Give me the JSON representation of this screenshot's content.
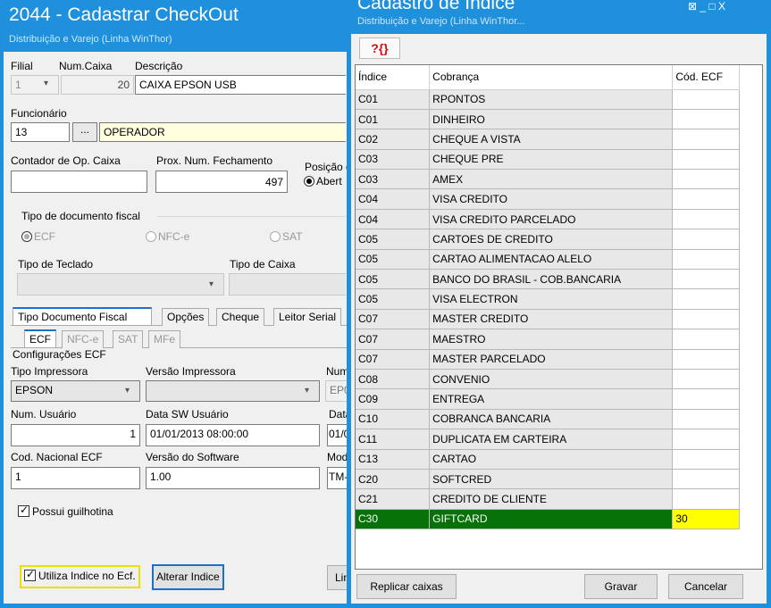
{
  "back": {
    "title": "2044 - Cadastrar CheckOut",
    "subtitle": "Distribuição e Varejo (Linha WinThor)",
    "filial_label": "Filial",
    "filial_value": "1",
    "numcaixa_label": "Num.Caixa",
    "numcaixa_value": "20",
    "descricao_label": "Descrição",
    "descricao_value": "CAIXA EPSON USB",
    "funcionario_label": "Funcionário",
    "funcionario_code": "13",
    "funcionario_btn": "...",
    "funcionario_name": "OPERADOR",
    "contador_label": "Contador de Op. Caixa",
    "contador_value": "",
    "prox_label": "Prox. Num. Fechamento",
    "prox_value": "497",
    "posicao_label": "Posição c",
    "posicao_option": "Abert",
    "tipodoc_label": "Tipo de documento fiscal",
    "tipodoc_options": [
      "ECF",
      "NFC-e",
      "SAT"
    ],
    "teclado_label": "Tipo de Teclado",
    "caixa_label": "Tipo de Caixa",
    "tabs_main": [
      "Tipo Documento Fiscal",
      "Opções",
      "Cheque",
      "Leitor Serial"
    ],
    "tabs_sub": [
      "ECF",
      "NFC-e",
      "SAT",
      "MFe"
    ],
    "config_label": "Configurações ECF",
    "impressora_label": "Tipo Impressora",
    "impressora_value": "EPSON",
    "versao_imp_label": "Versão Impressora",
    "num_label": "Num",
    "num_value": "EP0",
    "numusuario_label": "Num. Usuário",
    "numusuario_value": "1",
    "datasw_label": "Data  SW Usuário",
    "datasw_value": "01/01/2013 08:00:00",
    "data_label": "Data",
    "data_value": "01/0",
    "codnac_label": "Cod. Nacional ECF",
    "codnac_value": "1",
    "versaosw_label": "Versão do Software",
    "versaosw_value": "1.00",
    "modelo_label": "Mode",
    "modelo_value": "TM-",
    "guilhotina_label": "Possui guilhotina",
    "utiliza_label": "Utiliza Indice no Ecf.",
    "alterar_label": "Alterar Indice",
    "lim_label": "Lin"
  },
  "front": {
    "title": "Cadastro de Indice",
    "subtitle": "Distribuição e Varejo (Linha WinThor...",
    "window_controls": "⊠ _ □ X",
    "toolbar_icon": "?{}",
    "columns": [
      "Índice",
      "Cobrança",
      "Cód. ECF"
    ],
    "rows": [
      [
        "C01",
        "RPONTOS",
        ""
      ],
      [
        "C01",
        "DINHEIRO",
        ""
      ],
      [
        "C02",
        "CHEQUE A VISTA",
        ""
      ],
      [
        "C03",
        "CHEQUE PRE",
        ""
      ],
      [
        "C03",
        "AMEX",
        ""
      ],
      [
        "C04",
        "VISA CREDITO",
        ""
      ],
      [
        "C04",
        "VISA CREDITO PARCELADO",
        ""
      ],
      [
        "C05",
        "CARTOES DE CREDITO",
        ""
      ],
      [
        "C05",
        "CARTAO ALIMENTACAO ALELO",
        ""
      ],
      [
        "C05",
        "BANCO DO BRASIL - COB.BANCARIA",
        ""
      ],
      [
        "C05",
        "VISA ELECTRON",
        ""
      ],
      [
        "C07",
        "MASTER CREDITO",
        ""
      ],
      [
        "C07",
        "MAESTRO",
        ""
      ],
      [
        "C07",
        "MASTER PARCELADO",
        ""
      ],
      [
        "C08",
        "CONVENIO",
        ""
      ],
      [
        "C09",
        "ENTREGA",
        ""
      ],
      [
        "C10",
        "COBRANCA BANCARIA",
        ""
      ],
      [
        "C11",
        "DUPLICATA EM CARTEIRA",
        ""
      ],
      [
        "C13",
        "CARTAO",
        ""
      ],
      [
        "C20",
        "SOFTCRED",
        ""
      ],
      [
        "C21",
        "CREDITO DE CLIENTE",
        ""
      ],
      [
        "C30",
        "GIFTCARD",
        "30"
      ]
    ],
    "selected_row": 21,
    "replicar_label": "Replicar caixas",
    "gravar_label": "Gravar",
    "cancelar_label": "Cancelar"
  },
  "colors": {
    "titlebar": "#1e90dc",
    "selected_row": "#077207",
    "highlight_cell": "#ffff00"
  }
}
